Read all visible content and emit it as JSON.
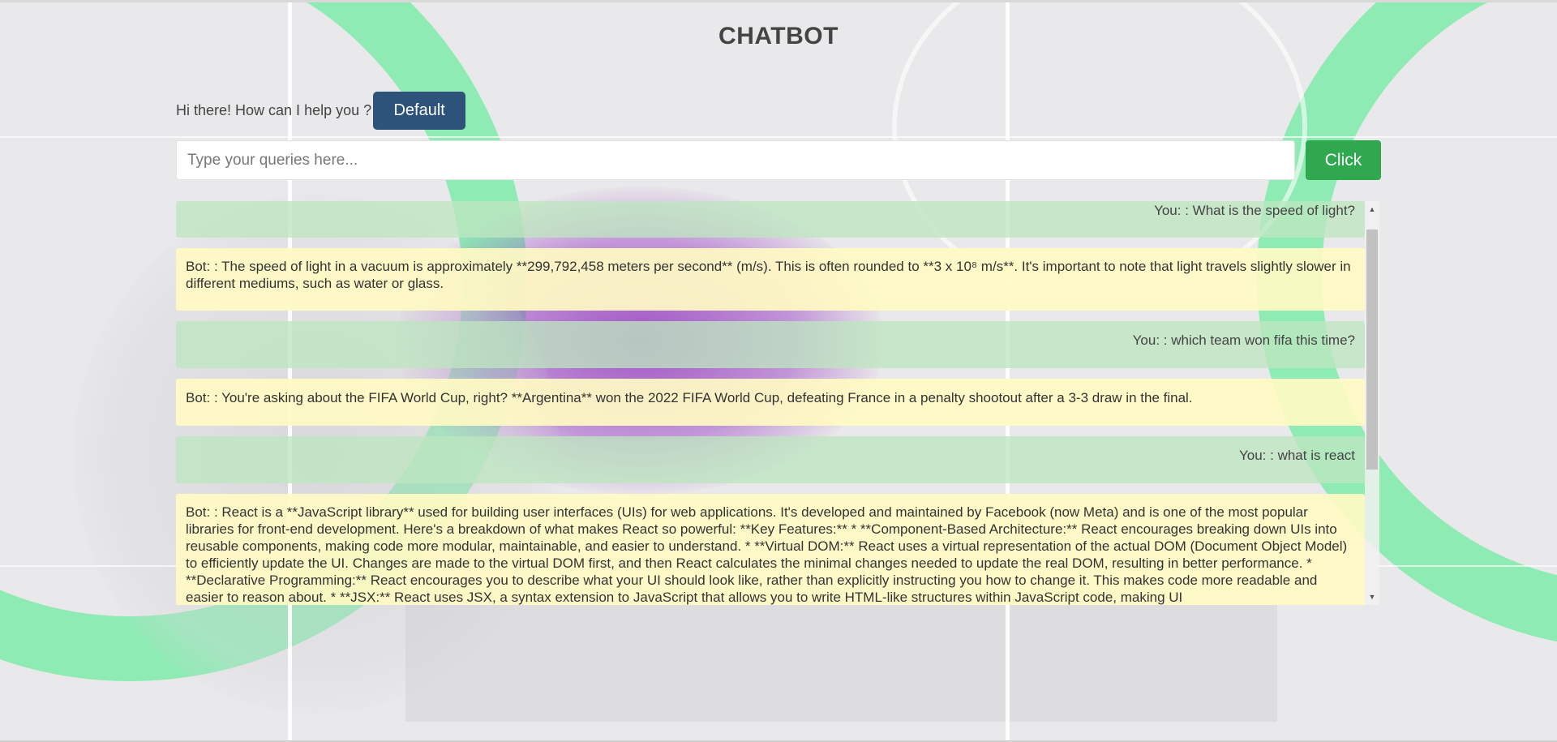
{
  "header": {
    "title": "CHATBOT"
  },
  "greeting": {
    "text": "Hi there! How can I help you ?",
    "default_button": "Default"
  },
  "query": {
    "placeholder": "Type your queries here...",
    "value": "",
    "submit_label": "Click"
  },
  "messages": [
    {
      "role": "user",
      "text": "You: : What is the speed of light?"
    },
    {
      "role": "bot",
      "text": "Bot: : The speed of light in a vacuum is approximately **299,792,458 meters per second** (m/s). This is often rounded to **3 x 10⁸ m/s**. It's important to note that light travels slightly slower in different mediums, such as water or glass."
    },
    {
      "role": "user",
      "text": "You: : which team won fifa this time?"
    },
    {
      "role": "bot",
      "text": "Bot: : You're asking about the FIFA World Cup, right? **Argentina** won the 2022 FIFA World Cup, defeating France in a penalty shootout after a 3-3 draw in the final."
    },
    {
      "role": "user",
      "text": "You: : what is react"
    },
    {
      "role": "bot",
      "text": "Bot: : React is a **JavaScript library** used for building user interfaces (UIs) for web applications. It's developed and maintained by Facebook (now Meta) and is one of the most popular libraries for front-end development. Here's a breakdown of what makes React so powerful: **Key Features:** * **Component-Based Architecture:** React encourages breaking down UIs into reusable components, making code more modular, maintainable, and easier to understand. * **Virtual DOM:** React uses a virtual representation of the actual DOM (Document Object Model) to efficiently update the UI. Changes are made to the virtual DOM first, and then React calculates the minimal changes needed to update the real DOM, resulting in better performance. * **Declarative Programming:** React encourages you to describe what your UI should look like, rather than explicitly instructing you how to change it. This makes code more readable and easier to reason about. * **JSX:** React uses JSX, a syntax extension to JavaScript that allows you to write HTML-like structures within JavaScript code, making UI"
    }
  ],
  "colors": {
    "default_button": "#2e537a",
    "click_button": "#2fa84f",
    "user_bubble": "#bee5c0",
    "bot_bubble": "#fffac3"
  },
  "icons": {
    "scroll_up": "triangle-up-icon",
    "scroll_down": "triangle-down-icon"
  }
}
